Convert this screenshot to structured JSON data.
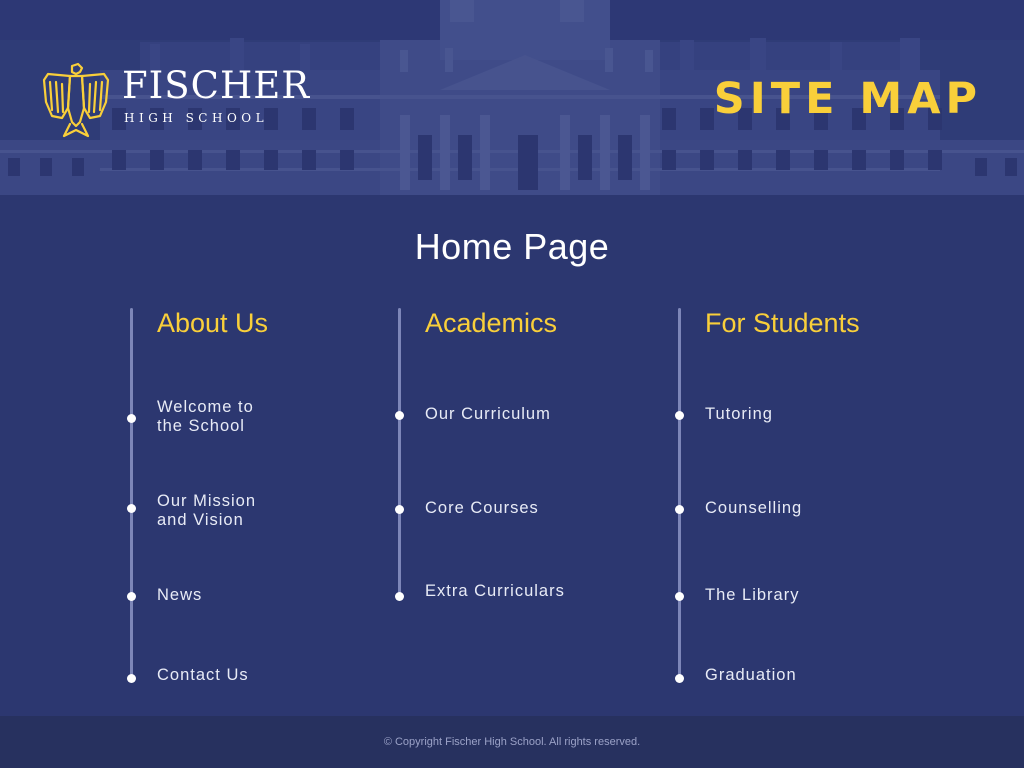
{
  "brand": {
    "name": "FISCHER",
    "subtitle": "HIGH SCHOOL"
  },
  "header": {
    "title": "SITE MAP"
  },
  "main": {
    "home_label": "Home Page",
    "columns": [
      {
        "heading": "About Us",
        "items": [
          {
            "label": "Welcome to\nthe School"
          },
          {
            "label": "Our Mission\nand Vision"
          },
          {
            "label": "News"
          },
          {
            "label": "Contact Us"
          }
        ]
      },
      {
        "heading": "Academics",
        "items": [
          {
            "label": "Our Curriculum"
          },
          {
            "label": "Core Courses"
          },
          {
            "label": "Extra Curriculars"
          }
        ]
      },
      {
        "heading": "For Students",
        "items": [
          {
            "label": "Tutoring"
          },
          {
            "label": "Counselling"
          },
          {
            "label": "The Library"
          },
          {
            "label": "Graduation"
          }
        ]
      }
    ]
  },
  "footer": {
    "copyright": "© Copyright Fischer High School. All rights reserved."
  },
  "colors": {
    "background": "#2c3770",
    "accent": "#f9cf3a",
    "footer": "#27315f"
  },
  "icons": {
    "logo": "eagle-crest-icon",
    "bullet": "dot-icon"
  }
}
